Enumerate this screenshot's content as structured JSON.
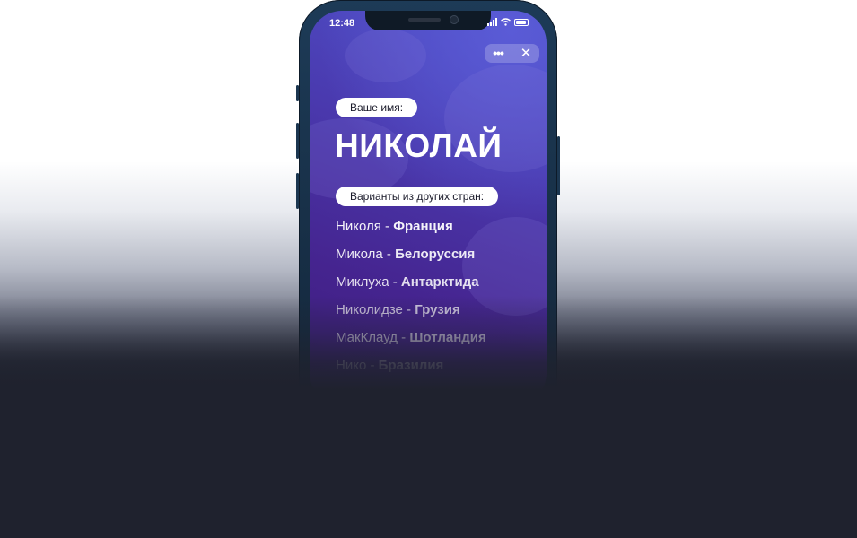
{
  "status_bar": {
    "time": "12:48",
    "icons": [
      "signal-icon",
      "wifi-icon",
      "battery-icon"
    ]
  },
  "controls": {
    "more_label": "•••",
    "close_label": "✕"
  },
  "content": {
    "name_pill": "Ваше имя:",
    "name": "НИКОЛАЙ",
    "variants_pill": "Варианты из других стран:",
    "variants": [
      {
        "name": "Николя",
        "separator": " - ",
        "country": "Франция"
      },
      {
        "name": "Микола",
        "separator": " - ",
        "country": "Белоруссия"
      },
      {
        "name": "Миклуха",
        "separator": " - ",
        "country": "Антарктида"
      },
      {
        "name": "Николидзе",
        "separator": " - ",
        "country": "Грузия"
      },
      {
        "name": "МакКлауд",
        "separator": " - ",
        "country": "Шотландия"
      },
      {
        "name": "Нико",
        "separator": " - ",
        "country": "Бразилия"
      }
    ]
  },
  "colors": {
    "background_dark": "#1f222e",
    "screen_gradient_top": "#4f50c8",
    "screen_gradient_bottom": "#3c1c7a",
    "phone_frame": "#1d3b57"
  }
}
